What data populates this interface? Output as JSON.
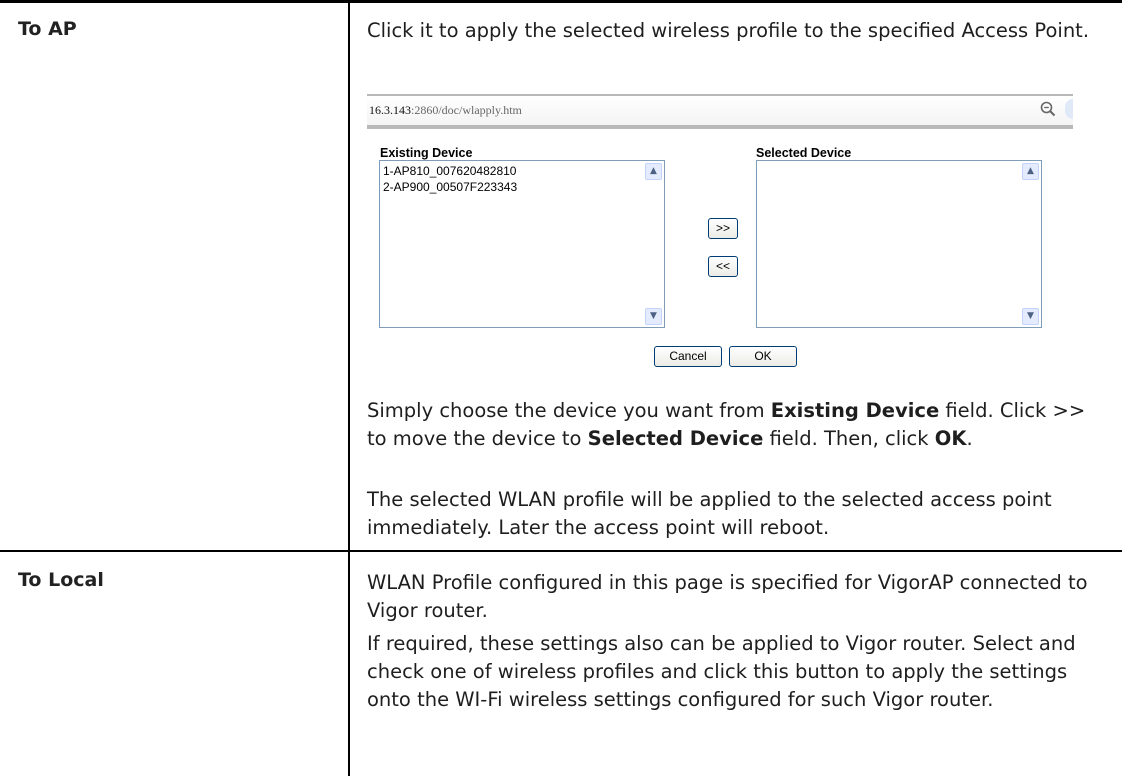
{
  "rows": [
    {
      "term": "To AP",
      "intro": "Click it to apply the selected wireless profile to the specified Access Point.",
      "dialog": {
        "address": "16.3.143:2860/doc/wlapply.htm",
        "existing_label": "Existing Device",
        "selected_label": "Selected Device",
        "existing_items": [
          "1-AP810_007620482810",
          "2-AP900_00507F223343"
        ],
        "selected_items": [],
        "move_right_label": ">>",
        "move_left_label": "<<",
        "cancel_label": "Cancel",
        "ok_label": "OK"
      },
      "step": {
        "p1": "Simply choose the device you want from ",
        "b1": "Existing Device",
        "p2": " field. Click >> to move the device to ",
        "b2": "Selected Device",
        "p3": " field. Then, click ",
        "b3": "OK",
        "p4": "."
      },
      "note": "The selected WLAN profile will be applied to the selected access point immediately. Later the access point will reboot."
    },
    {
      "term": "To Local",
      "p1": "WLAN Profile configured in this page is specified for VigorAP connected to Vigor router.",
      "p2": "If required, these settings also can be applied to Vigor router. Select and check one of wireless profiles and click this button to apply the settings onto the WI-Fi wireless settings configured for such Vigor router."
    }
  ]
}
